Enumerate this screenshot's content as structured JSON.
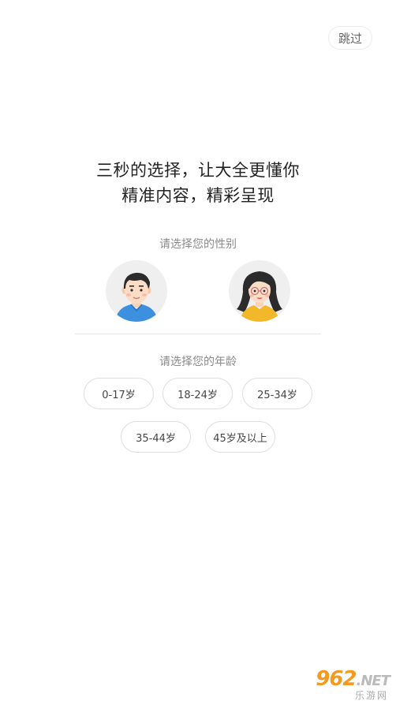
{
  "header": {
    "skip_label": "跳过"
  },
  "headline": {
    "line1": "三秒的选择，让大全更懂你",
    "line2": "精准内容，精彩呈现"
  },
  "gender": {
    "label": "请选择您的性别",
    "options": [
      {
        "icon": "male-avatar-icon"
      },
      {
        "icon": "female-avatar-icon"
      }
    ]
  },
  "age": {
    "label": "请选择您的年龄",
    "options": [
      "0-17岁",
      "18-24岁",
      "25-34岁",
      "35-44岁",
      "45岁及以上"
    ]
  },
  "watermark": {
    "brand": "962",
    "suffix": ".NET",
    "subtitle": "乐游网"
  },
  "colors": {
    "male_shirt": "#3d8fe0",
    "female_shirt": "#f3b72a",
    "avatar_bg": "#efefef",
    "watermark": "#f39a1f"
  }
}
